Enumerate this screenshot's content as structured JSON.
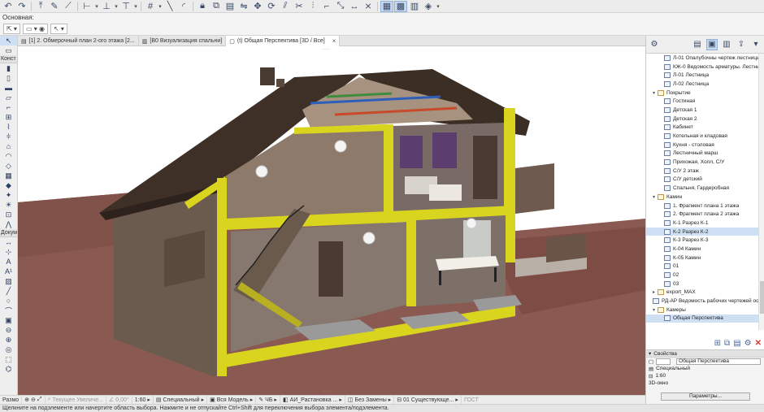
{
  "info_label": "Основная:",
  "tabs": [
    {
      "label": "[1] 2. Обмерочный план 2-ого этажа [2...",
      "active": false
    },
    {
      "label": "[B0 Визуализация спальни]",
      "active": false
    },
    {
      "label": "(t) Общая Перспектива [3D / Все]",
      "active": true
    }
  ],
  "toolbox": {
    "construct_label": "Конст",
    "document_label": "Докум"
  },
  "navigator": {
    "items": [
      {
        "label": "Л-01 Опалубочны чертеж лестницы",
        "level": 2,
        "type": "sheet"
      },
      {
        "label": "КЖ-0 Ведомость арматуры. Лестница",
        "level": 2,
        "type": "sheet"
      },
      {
        "label": "Л-01 Лестница",
        "level": 2,
        "type": "sheet"
      },
      {
        "label": "Л-02 Лестница",
        "level": 2,
        "type": "sheet"
      },
      {
        "label": "Покрытие",
        "level": 1,
        "type": "folder",
        "open": true
      },
      {
        "label": "Гостиная",
        "level": 2,
        "type": "sheet"
      },
      {
        "label": "Детская 1",
        "level": 2,
        "type": "sheet"
      },
      {
        "label": "Детская 2",
        "level": 2,
        "type": "sheet"
      },
      {
        "label": "Кабинет",
        "level": 2,
        "type": "sheet"
      },
      {
        "label": "Котельная и кладовая",
        "level": 2,
        "type": "sheet"
      },
      {
        "label": "Кухня - столовая",
        "level": 2,
        "type": "sheet"
      },
      {
        "label": "Лестничный марш",
        "level": 2,
        "type": "sheet"
      },
      {
        "label": "Прихожая, Холл, С/У",
        "level": 2,
        "type": "sheet"
      },
      {
        "label": "С/У 2 этаж",
        "level": 2,
        "type": "sheet"
      },
      {
        "label": "С/У детский",
        "level": 2,
        "type": "sheet"
      },
      {
        "label": "Спальня, Гардеробная",
        "level": 2,
        "type": "sheet"
      },
      {
        "label": "Камин",
        "level": 1,
        "type": "folder",
        "open": true
      },
      {
        "label": "1. Фрагмент плана 1 этажа",
        "level": 2,
        "type": "sheet"
      },
      {
        "label": "2. Фрагмент плана 2 этажа",
        "level": 2,
        "type": "sheet"
      },
      {
        "label": "К-1 Разрез К-1",
        "level": 2,
        "type": "sheet"
      },
      {
        "label": "К-2 Разрез К-2",
        "level": 2,
        "type": "sheet",
        "selected": true
      },
      {
        "label": "К-3 Разрез К-3",
        "level": 2,
        "type": "sheet"
      },
      {
        "label": "К-04 Камин",
        "level": 2,
        "type": "sheet"
      },
      {
        "label": "К-05 Камин",
        "level": 2,
        "type": "sheet"
      },
      {
        "label": "01",
        "level": 2,
        "type": "sheet"
      },
      {
        "label": "02",
        "level": 2,
        "type": "sheet"
      },
      {
        "label": "03",
        "level": 2,
        "type": "sheet"
      },
      {
        "label": "export_MAX",
        "level": 1,
        "type": "folder",
        "open": false
      },
      {
        "label": "РД-АР Ведомость рабочих чертежей осно",
        "level": 1,
        "type": "sheet"
      },
      {
        "label": "Камеры",
        "level": 1,
        "type": "folder",
        "open": true
      },
      {
        "label": "Общая Перспектива",
        "level": 2,
        "type": "camera",
        "highlight": true
      }
    ]
  },
  "properties": {
    "header": "Свойства",
    "name_value": "Общая Перспектива",
    "type_label": "Специальный",
    "scale": "1:60",
    "window": "3D-окно",
    "params_button": "Параметры..."
  },
  "viewport_bar": {
    "undo_label": "Размо",
    "zoom_placeholder": "Текущее Увеличе...",
    "angle": "0,00°",
    "scale": "1:60",
    "structure": "Специальный",
    "model": "Вся Модель",
    "pen": "ЧБ",
    "override": "АИ_Растановка ...",
    "renovation": "Без Замены",
    "filter": "01 Существующе...",
    "dim": "ГОСТ"
  },
  "status_text": "Щелкните на подэлементе или начертите область выбора. Нажмите и не отпускайте Ctrl+Shift для переключения выбора элемента/подэлемента."
}
